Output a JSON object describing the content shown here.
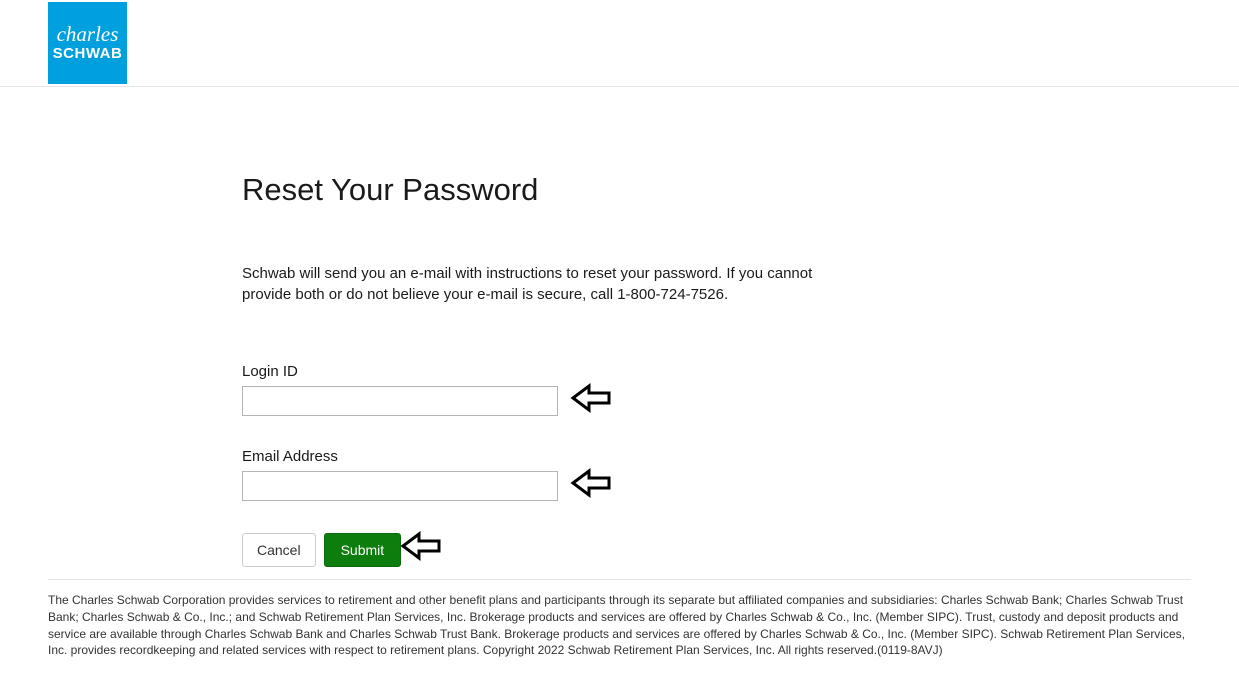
{
  "logo": {
    "line1": "charles",
    "line2": "SCHWAB"
  },
  "main": {
    "title": "Reset Your Password",
    "instructions": "Schwab will send you an e-mail with instructions to reset your password. If you cannot provide both or do not believe your e-mail is secure, call 1-800-724-7526.",
    "loginLabel": "Login ID",
    "loginValue": "",
    "emailLabel": "Email Address",
    "emailValue": "",
    "cancelLabel": "Cancel",
    "submitLabel": "Submit"
  },
  "footer": {
    "text": "The Charles Schwab Corporation provides services to retirement and other benefit plans and participants through its separate but affiliated companies and subsidiaries: Charles Schwab Bank; Charles Schwab Trust Bank; Charles Schwab & Co., Inc.; and Schwab Retirement Plan Services, Inc. Brokerage products and services are offered by Charles Schwab & Co., Inc. (Member SIPC). Trust, custody and deposit products and service are available through Charles Schwab Bank and Charles Schwab Trust Bank. Brokerage products and services are offered by Charles Schwab & Co., Inc. (Member SIPC). Schwab Retirement Plan Services, Inc. provides recordkeeping and related services with respect to retirement plans. Copyright 2022 Schwab Retirement Plan Services, Inc. All rights reserved.(0119-8AVJ)"
  }
}
